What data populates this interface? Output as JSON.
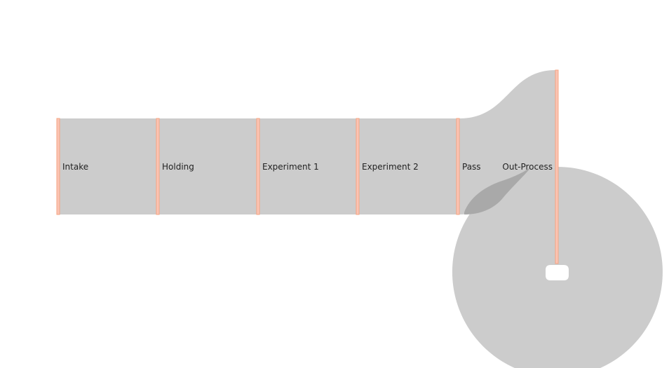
{
  "chart_data": {
    "type": "sankey",
    "nodes": [
      {
        "id": "intake",
        "label": "Intake"
      },
      {
        "id": "holding",
        "label": "Holding"
      },
      {
        "id": "exp1",
        "label": "Experiment 1"
      },
      {
        "id": "exp2",
        "label": "Experiment 2"
      },
      {
        "id": "pass",
        "label": "Pass"
      },
      {
        "id": "out",
        "label": "Out-Process"
      }
    ],
    "links": [
      {
        "source": "intake",
        "target": "holding",
        "value": 1
      },
      {
        "source": "holding",
        "target": "exp1",
        "value": 1
      },
      {
        "source": "exp1",
        "target": "exp2",
        "value": 1
      },
      {
        "source": "exp2",
        "target": "pass",
        "value": 1
      },
      {
        "source": "pass",
        "target": "out",
        "value": 1
      },
      {
        "source": "out",
        "target": "out",
        "value": 1
      }
    ],
    "colors": {
      "node": "#fbc4b4",
      "node_stroke": "#f4a582",
      "link": "#cccccc",
      "link_overlap": "#a9a9a9"
    }
  }
}
